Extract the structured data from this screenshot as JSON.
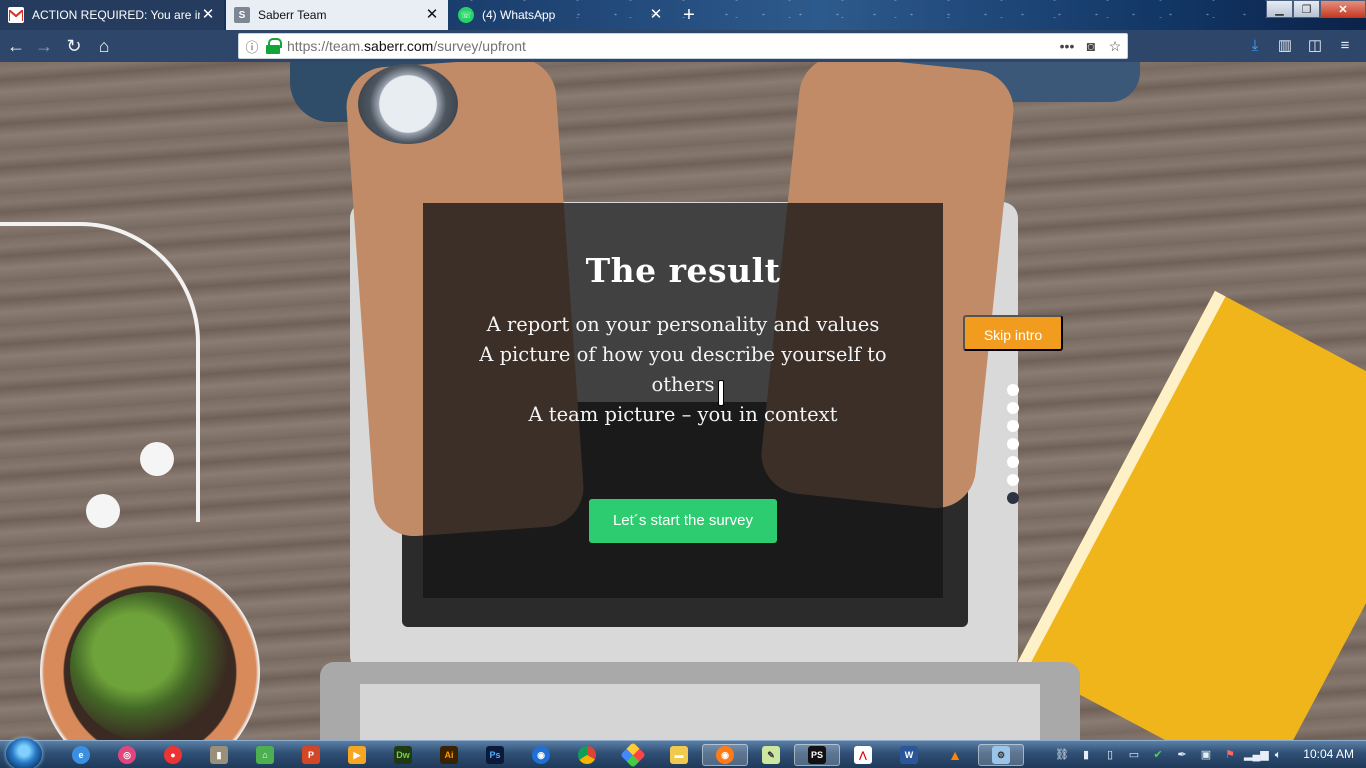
{
  "browser": {
    "tabs": [
      {
        "title": "ACTION REQUIRED: You are in",
        "favicon": "gmail-icon",
        "active": false
      },
      {
        "title": "Saberr Team",
        "favicon": "saberr-icon",
        "active": true
      },
      {
        "title": "(4) WhatsApp",
        "favicon": "whatsapp-icon",
        "active": false
      }
    ],
    "url_prefix": "https://team.",
    "url_domain": "saberr.com",
    "url_path": "/survey/upfront"
  },
  "survey": {
    "title": "The result",
    "lines": [
      "A report on your personality and values",
      "A picture of how you describe yourself to others",
      "A team picture – you in context"
    ],
    "start_button": "Let´s start the survey",
    "skip_button": "Skip intro",
    "progress_dots": 7,
    "active_dot": 7
  },
  "colors": {
    "start_button": "#2ecc71",
    "skip_button": "#f29c1f",
    "overlay": "#161616"
  },
  "taskbar": {
    "apps": [
      "internet-explorer-icon",
      "paint-icon",
      "screen-recorder-icon",
      "usb-icon",
      "home-icon",
      "powerpoint-icon",
      "media-player-icon",
      "dreamweaver-icon",
      "illustrator-icon",
      "photoshop-icon",
      "firefox-icon",
      "chrome-icon",
      "pinwheel-icon",
      "folder-icon",
      "firefox-active-icon",
      "notepad-icon",
      "photoshop-active-icon",
      "acrobat-icon",
      "word-icon",
      "vlc-icon",
      "control-panel-icon"
    ],
    "clock": "10:04 AM"
  }
}
